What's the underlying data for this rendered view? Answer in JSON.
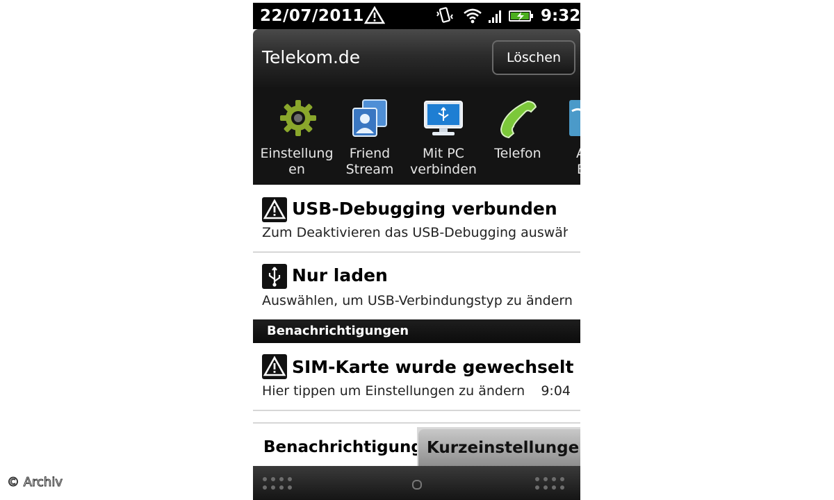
{
  "status_bar": {
    "date": "22/07/2011",
    "time": "9:32",
    "icons": [
      "warning-icon",
      "vibrate-icon",
      "wifi-icon",
      "signal-icon",
      "battery-icon"
    ]
  },
  "header": {
    "carrier": "Telekom.de",
    "clear_button": "Löschen"
  },
  "quick_apps": [
    {
      "label": "Einstellung\nen",
      "icon": "settings-gear-icon"
    },
    {
      "label": "Friend\nStream",
      "icon": "friend-stream-icon"
    },
    {
      "label": "Mit PC\nverbinden",
      "icon": "pc-connect-icon"
    },
    {
      "label": "Telefon",
      "icon": "phone-icon"
    },
    {
      "label": "A\nE",
      "icon": "app-icon"
    }
  ],
  "ongoing": [
    {
      "title": "USB-Debugging verbunden",
      "subtitle": "Zum Deaktivieren das USB-Debugging auswählen",
      "icon": "warning-icon"
    },
    {
      "title": "Nur laden",
      "subtitle": "Auswählen, um USB-Verbindungstyp zu ändern",
      "icon": "usb-icon"
    }
  ],
  "section": {
    "title": "Benachrichtigungen"
  },
  "notifications": [
    {
      "title": "SIM-Karte wurde gewechselt",
      "subtitle": "Hier tippen um Einstellungen zu ändern",
      "time": "9:04",
      "icon": "warning-icon"
    }
  ],
  "tabs": [
    {
      "label": "Benachrichtigungen",
      "active": true
    },
    {
      "label": "Kurzeinstellungen",
      "active": false
    }
  ],
  "watermark": "© Archiv"
}
